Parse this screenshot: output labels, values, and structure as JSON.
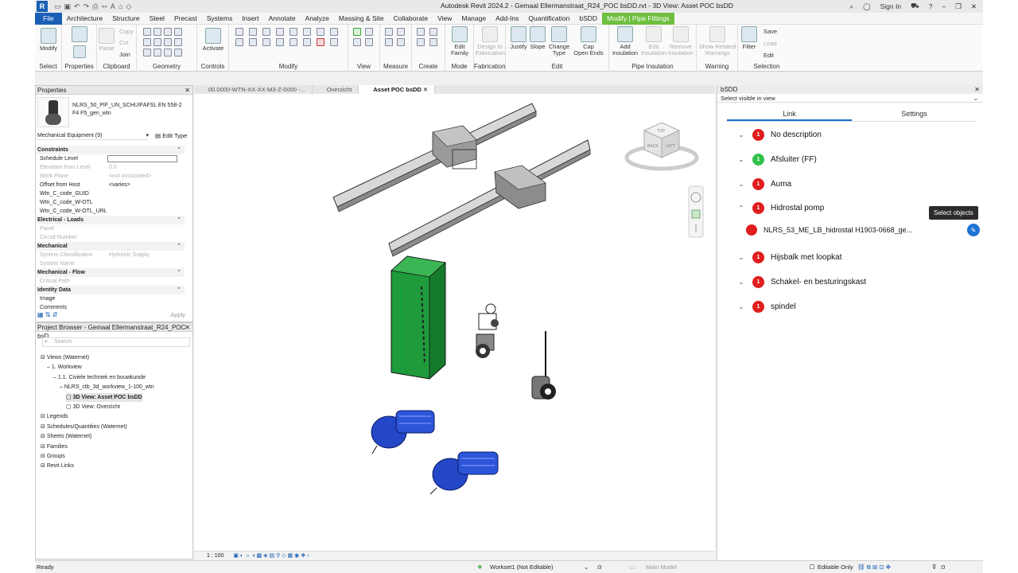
{
  "window": {
    "title": "Autodesk Revit 2024.2 - Gemaal Ellermanstraat_R24_POC bsDD.rvt - 3D View: Asset POC bsDD",
    "sign_in": "Sign In"
  },
  "menu": [
    "File",
    "Architecture",
    "Structure",
    "Steel",
    "Precast",
    "Systems",
    "Insert",
    "Annotate",
    "Analyze",
    "Massing & Site",
    "Collaborate",
    "View",
    "Manage",
    "Add-Ins",
    "Quantification",
    "bSDD",
    "Modify | Pipe Fittings"
  ],
  "ribbon": {
    "modify": "Modify",
    "select": "Select",
    "properties": "Properties",
    "clipboard": "Clipboard",
    "copy": "Copy",
    "cut": "Cut",
    "join": "Join",
    "paste": "Paste",
    "geometry": "Geometry",
    "activate": "Activate",
    "controls": "Controls",
    "modify_group": "Modify",
    "view": "View",
    "measure": "Measure",
    "create": "Create",
    "edit_family_1": "Edit",
    "edit_family_2": "Family",
    "mode": "Mode",
    "design_1": "Design to",
    "design_2": "Fabrication",
    "fabrication": "Fabrication",
    "justify": "Justify",
    "slope": "Slope",
    "change_1": "Change",
    "change_2": "Type",
    "cap_1": "Cap",
    "cap_2": "Open Ends",
    "edit": "Edit",
    "add_ins_1": "Add",
    "add_ins_2": "Insulation",
    "edit_ins_1": "Edit",
    "edit_ins_2": "Insulation",
    "remove_ins_1": "Remove",
    "remove_ins_2": "Insulation",
    "pipe_insulation": "Pipe Insulation",
    "show_warn_1": "Show Related",
    "show_warn_2": "Warnings",
    "warning": "Warning",
    "filter": "Filter",
    "save": "Save",
    "load": "Load",
    "edit_sel": "Edit",
    "selection": "Selection"
  },
  "properties": {
    "title": "Properties",
    "type_name": "NLRS_50_PIF_UN_SCHUIFAFSL EN 558-2 F4 F5_gen_wtn",
    "filter": "Mechanical Equipment (9)",
    "edit_type": "Edit Type",
    "apply": "Apply",
    "sections": [
      {
        "label": "Constraints",
        "rows": [
          {
            "label": "Schedule Level",
            "value": "",
            "dim": false
          },
          {
            "label": "Elevation from Level",
            "value": "0.0",
            "dim": true
          },
          {
            "label": "Work Plane",
            "value": "<not associated>",
            "dim": true
          },
          {
            "label": "Offset from Host",
            "value": "<varies>",
            "dim": false
          },
          {
            "label": "Wtn_C_code_GUID",
            "value": "",
            "dim": false
          },
          {
            "label": "Wtn_C_code_W-OTL",
            "value": "",
            "dim": false
          },
          {
            "label": "Wtn_C_code_W-OTL_URL",
            "value": "",
            "dim": false
          }
        ]
      },
      {
        "label": "Electrical - Loads",
        "rows": [
          {
            "label": "Panel",
            "value": "",
            "dim": true
          },
          {
            "label": "Circuit Number",
            "value": "",
            "dim": true
          }
        ]
      },
      {
        "label": "Mechanical",
        "rows": [
          {
            "label": "System Classification",
            "value": "Hydronic Supply",
            "dim": true
          },
          {
            "label": "System Name",
            "value": "",
            "dim": true
          }
        ]
      },
      {
        "label": "Mechanical - Flow",
        "rows": [
          {
            "label": "Critical Path",
            "value": "",
            "dim": true
          }
        ]
      },
      {
        "label": "Identity Data",
        "rows": [
          {
            "label": "Image",
            "value": "",
            "dim": false
          },
          {
            "label": "Comments",
            "value": "",
            "dim": false
          }
        ]
      }
    ]
  },
  "browser": {
    "title": "Project Browser - Gemaal Ellermanstraat_R24_POC bsD...",
    "search_placeholder": "Search",
    "items": [
      {
        "label": "Views (Waternet)",
        "indent": 0,
        "sel": false
      },
      {
        "label": "1. Workview",
        "indent": 1,
        "sel": false
      },
      {
        "label": "1.1. Civiele techniek en bouwkunde",
        "indent": 2,
        "sel": false
      },
      {
        "label": "NLRS_ctb_3d_workview_1-100_wtn",
        "indent": 3,
        "sel": false
      },
      {
        "label": "3D View: Asset POC bsDD",
        "indent": 4,
        "sel": true
      },
      {
        "label": "3D View: Overzicht",
        "indent": 4,
        "sel": false
      },
      {
        "label": "Legends",
        "indent": 0,
        "sel": false
      },
      {
        "label": "Schedules/Quantities (Waternet)",
        "indent": 0,
        "sel": false
      },
      {
        "label": "Sheets (Waternet)",
        "indent": 0,
        "sel": false
      },
      {
        "label": "Families",
        "indent": 0,
        "sel": false
      },
      {
        "label": "Groups",
        "indent": 0,
        "sel": false
      },
      {
        "label": "Revit Links",
        "indent": 0,
        "sel": false
      }
    ]
  },
  "doc_tabs": [
    {
      "label": "00.0000-WTN-XX-XX-M3-Z-0000 -...",
      "active": false
    },
    {
      "label": "Overzicht",
      "active": false
    },
    {
      "label": "Asset POC bsDD",
      "active": true
    }
  ],
  "view": {
    "scale": "1 : 100",
    "cube_top": "TOP",
    "cube_left": "LEFT",
    "cube_back": "BACK"
  },
  "bsdd": {
    "title": "bSDD",
    "scope": "Select visible in view",
    "tabs": [
      "Link",
      "Settings"
    ],
    "classes": [
      {
        "label": "No description",
        "count": "1",
        "color": "red",
        "expanded": false
      },
      {
        "label": "Afsluiter (FF)",
        "count": "1",
        "color": "green",
        "expanded": false
      },
      {
        "label": "Auma",
        "count": "1",
        "color": "red",
        "expanded": false
      },
      {
        "label": "Hidrostal pomp",
        "count": "1",
        "color": "red",
        "expanded": true
      },
      {
        "label": "Hijsbalk met loopkat",
        "count": "1",
        "color": "red",
        "expanded": false
      },
      {
        "label": "Schakel- en besturingskast",
        "count": "1",
        "color": "red",
        "expanded": false
      },
      {
        "label": "spindel",
        "count": "1",
        "color": "red",
        "expanded": false
      }
    ],
    "child_object": "NLRS_53_ME_LB_hidrostal H1903-0668_ge...",
    "tooltip": "Select objects"
  },
  "status": {
    "ready": "Ready",
    "workset": "Workset1 (Not Editable)",
    "zero": ":0",
    "model": "Main Model",
    "editable_only": "Editable Only",
    "filter_count": ":0"
  },
  "colors": {
    "accent": "#1f6fd1",
    "file_tab": "#1a5fb4",
    "context_tab": "#6fbf3f",
    "badge_red": "#e01e1e",
    "badge_green": "#33c24a"
  }
}
